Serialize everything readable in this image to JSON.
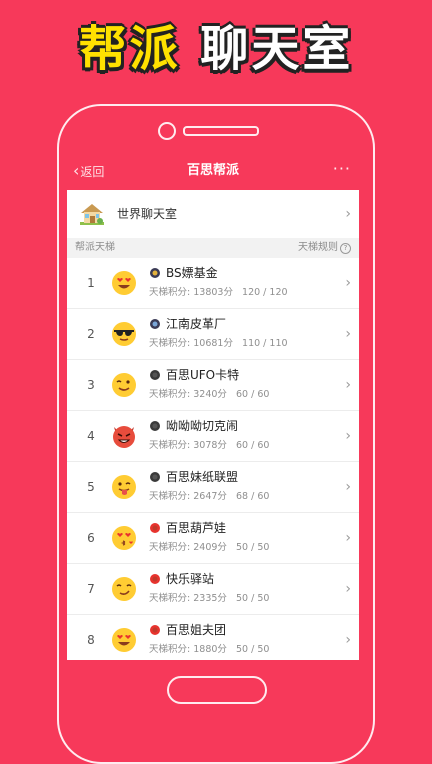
{
  "banner": {
    "word1": "帮派",
    "word2": "聊天室"
  },
  "nav": {
    "back": "返回",
    "title": "百思帮派",
    "more": "···"
  },
  "world_chat": {
    "label": "世界聊天室"
  },
  "section": {
    "left": "帮派天梯",
    "right": "天梯规则",
    "help": "?"
  },
  "colors": {
    "accent": "#f7395a",
    "banner_yellow": "#ffe100"
  },
  "gangs": [
    {
      "rank": "1",
      "name": "BS嫖基金",
      "score_label": "天梯积分:",
      "score": "13803分",
      "members": "120 / 120",
      "avatar": "heart-eyes-emoji-icon",
      "badge": "gang-badge-icon"
    },
    {
      "rank": "2",
      "name": "江南皮革厂",
      "score_label": "天梯积分:",
      "score": "10681分",
      "members": "110 / 110",
      "avatar": "sunglasses-emoji-icon",
      "badge": "gang-badge-icon"
    },
    {
      "rank": "3",
      "name": "百思UFO卡特",
      "score_label": "天梯积分:",
      "score": "3240分",
      "members": "60 / 60",
      "avatar": "wink-emoji-icon",
      "badge": "gang-badge-icon"
    },
    {
      "rank": "4",
      "name": "呦呦呦切克闹",
      "score_label": "天梯积分:",
      "score": "3078分",
      "members": "60 / 60",
      "avatar": "devil-emoji-icon",
      "badge": "gang-badge-icon"
    },
    {
      "rank": "5",
      "name": "百思妹纸联盟",
      "score_label": "天梯积分:",
      "score": "2647分",
      "members": "68 / 60",
      "avatar": "tongue-emoji-icon",
      "badge": "gang-badge-icon"
    },
    {
      "rank": "6",
      "name": "百思葫芦娃",
      "score_label": "天梯积分:",
      "score": "2409分",
      "members": "50 / 50",
      "avatar": "kiss-emoji-icon",
      "badge": "gang-badge-icon"
    },
    {
      "rank": "7",
      "name": "快乐驿站",
      "score_label": "天梯积分:",
      "score": "2335分",
      "members": "50 / 50",
      "avatar": "smirk-emoji-icon",
      "badge": "gang-badge-icon"
    },
    {
      "rank": "8",
      "name": "百思姐夫团",
      "score_label": "天梯积分:",
      "score": "1880分",
      "members": "50 / 50",
      "avatar": "heart-eyes-emoji-icon",
      "badge": "gang-badge-icon"
    }
  ]
}
